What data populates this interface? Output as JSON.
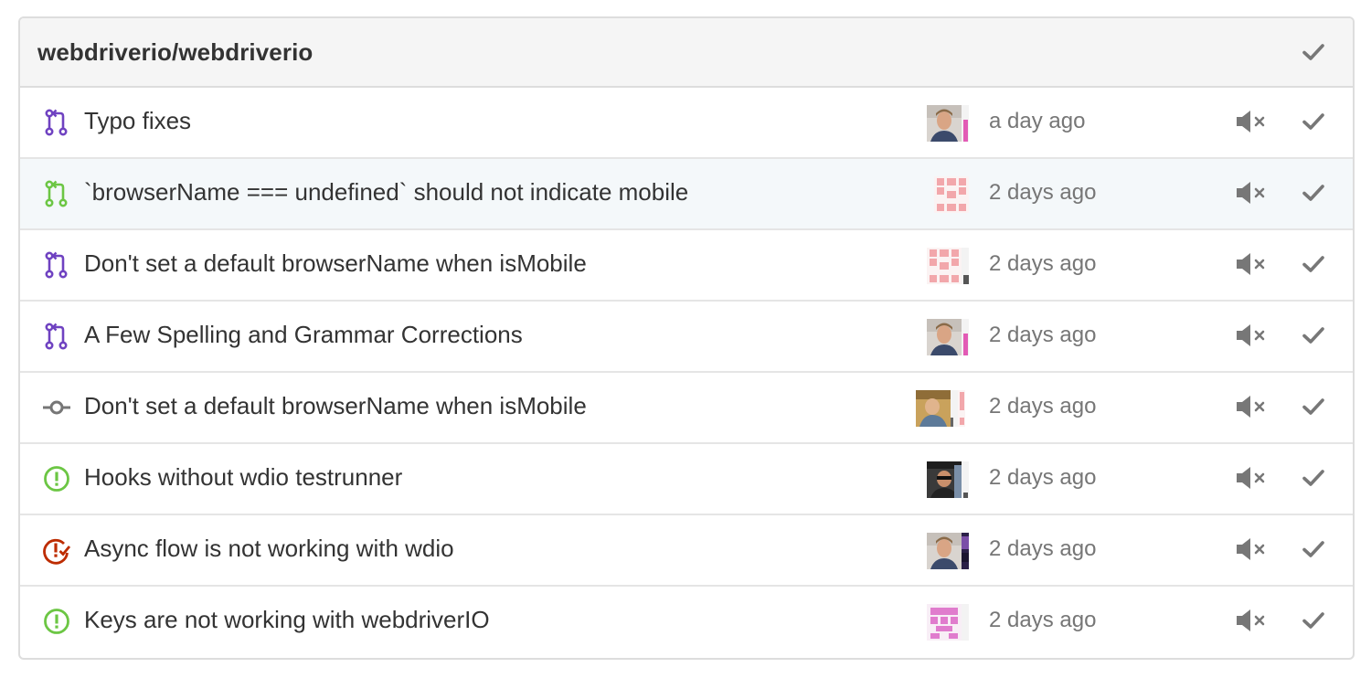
{
  "repo": {
    "name": "webdriverio/webdriverio"
  },
  "colors": {
    "pr_open": "#6f42c1",
    "pr_green": "#6cc644",
    "issue_open": "#6cc644",
    "issue_closed": "#bd2c00",
    "commit": "#767676",
    "muted": "#767676"
  },
  "notifications": [
    {
      "type": "pull-request-merged",
      "icon": "git-pull-request-icon",
      "title": "Typo fixes",
      "time": "a day ago"
    },
    {
      "type": "pull-request-open",
      "icon": "git-pull-request-icon",
      "title": "`browserName === undefined` should not indicate mobile",
      "time": "2 days ago"
    },
    {
      "type": "pull-request-merged",
      "icon": "git-pull-request-icon",
      "title": "Don't set a default browserName when isMobile",
      "time": "2 days ago"
    },
    {
      "type": "pull-request-merged",
      "icon": "git-pull-request-icon",
      "title": "A Few Spelling and Grammar Corrections",
      "time": "2 days ago"
    },
    {
      "type": "commit",
      "icon": "git-commit-icon",
      "title": "Don't set a default browserName when isMobile",
      "time": "2 days ago"
    },
    {
      "type": "issue-open",
      "icon": "issue-opened-icon",
      "title": "Hooks without wdio testrunner",
      "time": "2 days ago"
    },
    {
      "type": "issue-closed",
      "icon": "issue-closed-icon",
      "title": "Async flow is not working with wdio",
      "time": "2 days ago"
    },
    {
      "type": "issue-open",
      "icon": "issue-opened-icon",
      "title": "Keys are not working with webdriverIO",
      "time": "2 days ago"
    }
  ]
}
